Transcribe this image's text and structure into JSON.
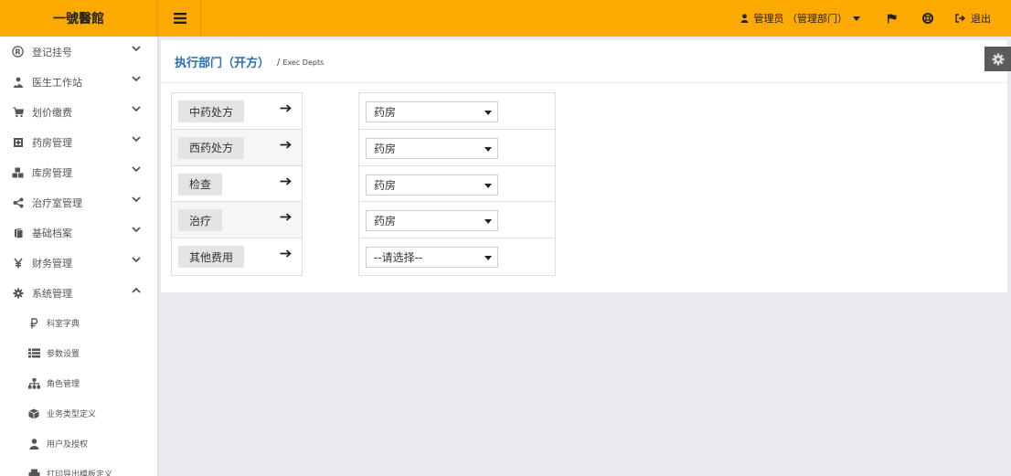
{
  "brand": "一號醫館",
  "header": {
    "user": "管理员 （管理部门）",
    "logout": "退出"
  },
  "sidebar": {
    "items": [
      {
        "label": "登记挂号",
        "icon": "registered-icon",
        "expanded": false
      },
      {
        "label": "医生工作站",
        "icon": "doctor-icon",
        "expanded": false
      },
      {
        "label": "划价缴费",
        "icon": "cart-icon",
        "expanded": false
      },
      {
        "label": "药房管理",
        "icon": "pharmacy-icon",
        "expanded": false
      },
      {
        "label": "库房管理",
        "icon": "cubes-icon",
        "expanded": false
      },
      {
        "label": "治疗室管理",
        "icon": "share-icon",
        "expanded": false
      },
      {
        "label": "基础档案",
        "icon": "book-icon",
        "expanded": false
      },
      {
        "label": "财务管理",
        "icon": "yen-icon",
        "expanded": false
      },
      {
        "label": "系统管理",
        "icon": "cog-icon",
        "expanded": true
      }
    ],
    "subitems": [
      {
        "label": "科室字典",
        "icon": "ruble-icon"
      },
      {
        "label": "参数设置",
        "icon": "list-icon"
      },
      {
        "label": "角色管理",
        "icon": "sitemap-icon"
      },
      {
        "label": "业务类型定义",
        "icon": "cube-icon"
      },
      {
        "label": "用户及授权",
        "icon": "user-icon"
      },
      {
        "label": "打印导出模板定义",
        "icon": "print-icon"
      }
    ]
  },
  "page": {
    "title": "执行部门（开方）",
    "subtitle": "Exec Depts",
    "separator": "/"
  },
  "mappings": {
    "types": [
      "中药处方",
      "西药处方",
      "检查",
      "治疗",
      "其他费用"
    ],
    "departments": [
      "药房",
      "药房",
      "药房",
      "药房",
      "--请选择--"
    ]
  },
  "colors": {
    "topbar": "#fdaa00",
    "title": "#2a6fb4",
    "gear_button": "#5a5a5a"
  }
}
